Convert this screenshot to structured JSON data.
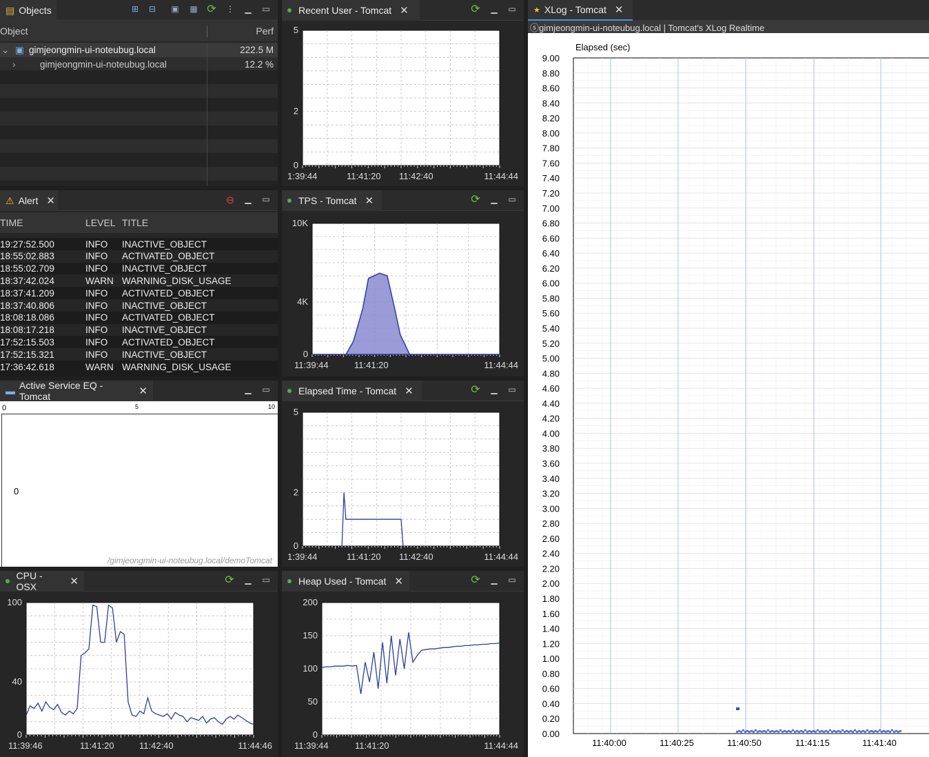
{
  "objects": {
    "tab_label": "Objects",
    "col_object": "Object",
    "col_perf": "Perf",
    "rows": [
      {
        "name": "gimjeongmin-ui-noteubug.local",
        "perf": "222.5 M"
      },
      {
        "name": "gimjeongmin-ui-noteubug.local",
        "perf": "12.2 %"
      }
    ]
  },
  "alert": {
    "tab_label": "Alert",
    "col_time": "TIME",
    "col_level": "LEVEL",
    "col_title": "TITLE",
    "rows": [
      {
        "time": "19:27:52.500",
        "level": "INFO",
        "title": "INACTIVE_OBJECT"
      },
      {
        "time": "18:55:02.883",
        "level": "INFO",
        "title": "ACTIVATED_OBJECT"
      },
      {
        "time": "18:55:02.709",
        "level": "INFO",
        "title": "INACTIVE_OBJECT"
      },
      {
        "time": "18:37:42.024",
        "level": "WARN",
        "title": "WARNING_DISK_USAGE"
      },
      {
        "time": "18:37:41.209",
        "level": "INFO",
        "title": "ACTIVATED_OBJECT"
      },
      {
        "time": "18:37:40.806",
        "level": "INFO",
        "title": "INACTIVE_OBJECT"
      },
      {
        "time": "18:08:18.086",
        "level": "INFO",
        "title": "ACTIVATED_OBJECT"
      },
      {
        "time": "18:08:17.218",
        "level": "INFO",
        "title": "INACTIVE_OBJECT"
      },
      {
        "time": "17:52:15.503",
        "level": "INFO",
        "title": "ACTIVATED_OBJECT"
      },
      {
        "time": "17:52:15.321",
        "level": "INFO",
        "title": "INACTIVE_OBJECT"
      },
      {
        "time": "17:36:42.618",
        "level": "WARN",
        "title": "WARNING_DISK_USAGE"
      }
    ]
  },
  "active_service": {
    "tab_label": "Active Service EQ - Tomcat",
    "scale": [
      "0",
      "5",
      "10"
    ],
    "value": "0",
    "path": "/gimjeongmin-ui-noteubug.local/demoTomcat"
  },
  "cpu": {
    "tab_label": "CPU - OSX"
  },
  "recent_user": {
    "tab_label": "Recent User - Tomcat"
  },
  "tps": {
    "tab_label": "TPS - Tomcat"
  },
  "elapsed": {
    "tab_label": "Elapsed Time - Tomcat"
  },
  "heap": {
    "tab_label": "Heap Used - Tomcat"
  },
  "xlog": {
    "tab_label": "XLog - Tomcat",
    "subtitle": "ⓢgimjeongmin-ui-noteubug.local | Tomcat's XLog Realtime"
  },
  "chart_data": [
    {
      "id": "recent_user",
      "type": "line",
      "yticks": [
        "5",
        "2",
        "0"
      ],
      "ylim": [
        0,
        5
      ],
      "xticks": [
        "1:39:44",
        "11:41:20",
        "11:42:40",
        "11:44:44"
      ],
      "values": []
    },
    {
      "id": "tps",
      "type": "area",
      "yticks": [
        "10K",
        "4K",
        "0"
      ],
      "ylim": [
        0,
        10000
      ],
      "xticks": [
        "11:39:44",
        "11:41:20",
        "11:44:44"
      ],
      "x": [
        0.0,
        0.18,
        0.22,
        0.27,
        0.3,
        0.36,
        0.4,
        0.44,
        0.47,
        0.52,
        1.0
      ],
      "values": [
        0,
        0,
        1000,
        3500,
        5800,
        6200,
        6000,
        3500,
        1500,
        0,
        0
      ],
      "color": "#8a8ad0"
    },
    {
      "id": "elapsed",
      "type": "line",
      "yticks": [
        "5",
        "2",
        "0"
      ],
      "ylim": [
        0,
        5
      ],
      "xticks": [
        "1:39:44",
        "11:41:20",
        "11:42:40",
        "11:44:44"
      ],
      "x": [
        0.2,
        0.21,
        0.22,
        0.5,
        0.51
      ],
      "values": [
        0,
        2.0,
        1.0,
        1.0,
        0
      ],
      "color": "#2b3ea0"
    },
    {
      "id": "cpu",
      "type": "line",
      "yticks": [
        "100",
        "40",
        "0"
      ],
      "ylim": [
        0,
        100
      ],
      "xticks": [
        "11:39:46",
        "11:41:20",
        "11:42:40",
        "11:44:46"
      ],
      "values": [
        15,
        22,
        20,
        24,
        18,
        25,
        21,
        19,
        23,
        17,
        15,
        18,
        16,
        20,
        60,
        62,
        65,
        98,
        97,
        70,
        70,
        98,
        96,
        70,
        78,
        76,
        25,
        15,
        14,
        18,
        16,
        28,
        18,
        16,
        15,
        14,
        16,
        12,
        17,
        15,
        14,
        10,
        13,
        12,
        11,
        14,
        9,
        12,
        13,
        10,
        8,
        12,
        14,
        12,
        15,
        13,
        11,
        9,
        8
      ],
      "color": "#2b3ea0"
    },
    {
      "id": "heap",
      "type": "line",
      "yticks": [
        "200",
        "150",
        "100",
        "50",
        "0"
      ],
      "ylim": [
        0,
        200
      ],
      "xticks": [
        "11:39:44",
        "11:41:20",
        "11:44:44"
      ],
      "values": [
        102,
        103,
        103,
        104,
        104,
        104,
        105,
        104,
        105,
        62,
        110,
        80,
        125,
        70,
        140,
        78,
        150,
        90,
        145,
        100,
        155,
        110,
        120,
        128,
        129,
        130,
        130,
        131,
        132,
        132,
        133,
        134,
        134,
        135,
        135,
        136,
        136,
        137,
        137,
        138,
        138,
        139
      ],
      "color": "#2b3ea0"
    },
    {
      "id": "xlog",
      "type": "scatter",
      "ylabel": "Elapsed (sec)",
      "yticks": [
        "9.00",
        "8.80",
        "8.60",
        "8.40",
        "8.20",
        "8.00",
        "7.80",
        "7.60",
        "7.40",
        "7.20",
        "7.00",
        "6.80",
        "6.60",
        "6.40",
        "6.20",
        "6.00",
        "5.80",
        "5.60",
        "5.40",
        "5.20",
        "5.00",
        "4.80",
        "4.60",
        "4.40",
        "4.20",
        "4.00",
        "3.80",
        "3.60",
        "3.40",
        "3.20",
        "3.00",
        "2.80",
        "2.60",
        "2.40",
        "2.20",
        "2.00",
        "1.80",
        "1.60",
        "1.40",
        "1.20",
        "1.00",
        "0.80",
        "0.60",
        "0.40",
        "0.20",
        "0.00"
      ],
      "ylim": [
        0,
        9
      ],
      "xticks": [
        "11:40:00",
        "11:40:25",
        "11:40:50",
        "11:41:15",
        "11:41:40"
      ],
      "points_y": [
        0.33,
        0.01,
        0.02,
        0.01,
        0.03,
        0.01,
        0.02
      ],
      "color": "#3050c8"
    }
  ]
}
